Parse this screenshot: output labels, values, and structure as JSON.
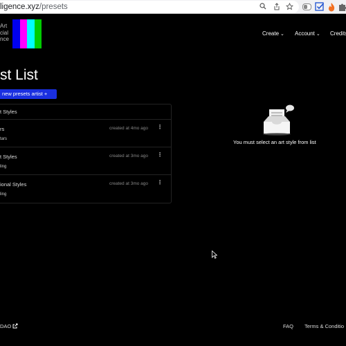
{
  "browser": {
    "url_host": "ligence.xyz",
    "url_path": "/presets",
    "icons": [
      "search-icon",
      "share-icon",
      "bookmark-star-icon",
      "extension-icon",
      "checklist-icon",
      "fire-icon",
      "puzzle-icon",
      "menu-icon"
    ]
  },
  "site": {
    "logo_lines": [
      "Art",
      "cial",
      "nce"
    ],
    "logo_colors": [
      "#0000ee",
      "#ff00ff",
      "#00ffff",
      "#00cc00"
    ],
    "nav": {
      "create": "Create",
      "account": "Account",
      "credits": "Credits"
    }
  },
  "page": {
    "title": "st List",
    "new_button": "new presets artist  +"
  },
  "list": {
    "header": "t Styles",
    "rows": [
      {
        "name": "rs",
        "date": "created at 4mo ago",
        "tag": "tars"
      },
      {
        "name": "t Styles",
        "date": "created at 3mo ago",
        "tag": "ling"
      },
      {
        "name": "ional Styles",
        "date": "created at 3mo ago",
        "tag": "ling"
      }
    ]
  },
  "empty_state": {
    "message": "You must select an art style from list"
  },
  "footer": {
    "dao": "DAO",
    "faq": "FAQ",
    "terms": "Terms & Conditio"
  }
}
